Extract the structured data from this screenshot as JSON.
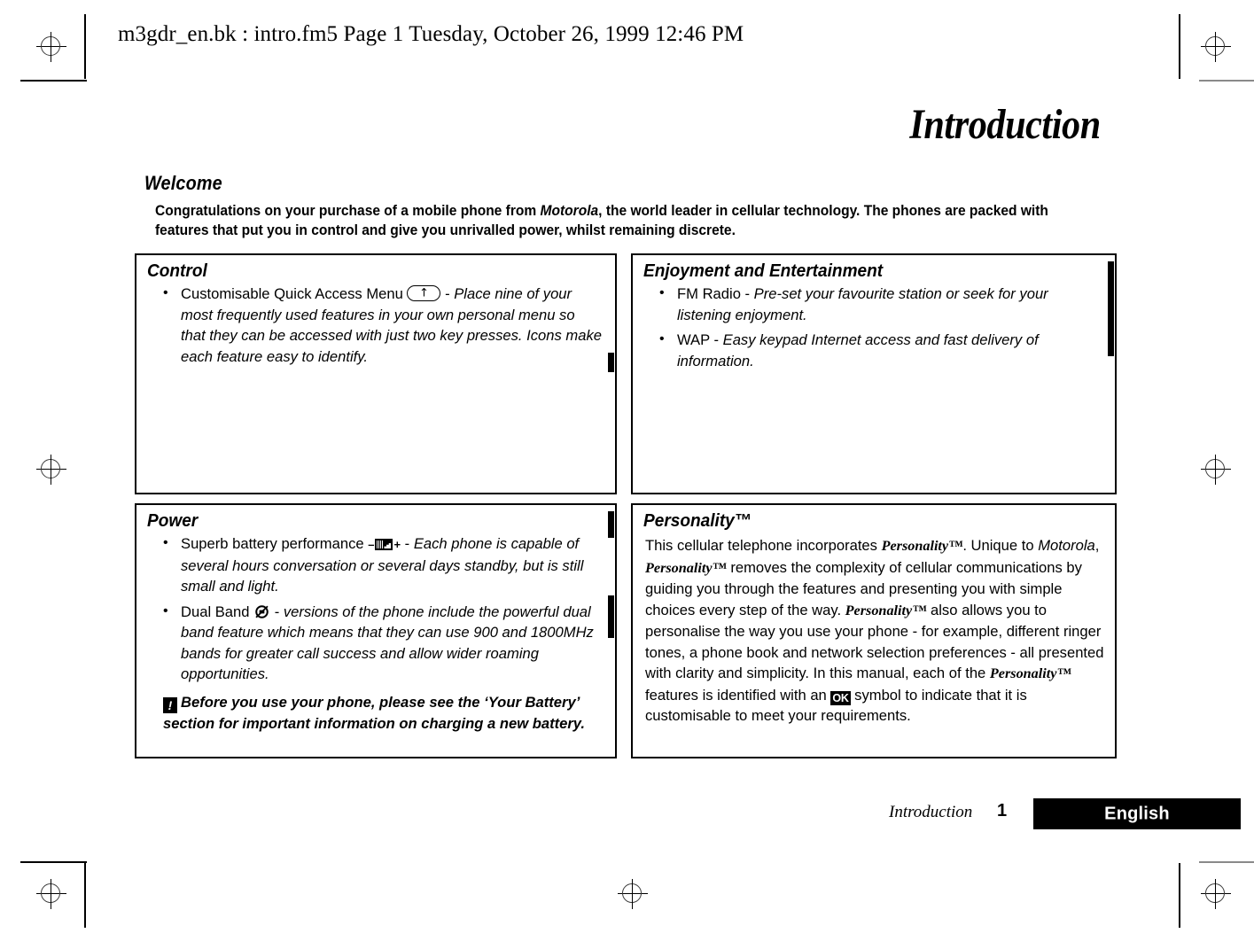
{
  "print_header": "m3gdr_en.bk : intro.fm5  Page 1  Tuesday, October 26, 1999  12:46 PM",
  "chapter_title": "Introduction",
  "welcome": {
    "heading": "Welcome",
    "body_part1": "Congratulations on your purchase of a mobile phone from ",
    "body_brand": "Motorola",
    "body_part2": ", the world leader in cellular technology. The phones are packed with features that put you in control and give you unrivalled power, whilst remaining discrete."
  },
  "boxes": {
    "control": {
      "heading": "Control",
      "items": [
        {
          "lead_a": "Customisable Quick Access Menu ",
          "icon": "quick-access-menu-icon",
          "lead_b": " - ",
          "desc": "Place nine of your most frequently used features in your own personal menu so that they can be accessed with just two key presses. Icons make each feature easy to identify."
        }
      ]
    },
    "enjoyment": {
      "heading": "Enjoyment and Entertainment",
      "items": [
        {
          "lead_a": "FM Radio - ",
          "desc": "Pre-set your favourite station or seek for your listening enjoyment."
        },
        {
          "lead_a": "WAP - ",
          "desc": "Easy keypad Internet access and fast delivery of information."
        }
      ]
    },
    "power": {
      "heading": "Power",
      "items": [
        {
          "lead_a": "Superb battery performance ",
          "icon": "battery-level-icon",
          "lead_b": " - ",
          "desc": "Each phone is capable of several hours conversation or several days standby, but is still small and light."
        },
        {
          "lead_a": "Dual Band ",
          "icon": "dual-band-icon",
          "lead_b": " - ",
          "desc": "versions of the phone include the powerful dual band feature which means that they can use 900 and 1800MHz bands for greater call success and allow wider roaming opportunities."
        }
      ],
      "warning_icon": "!",
      "warning": "Before you use your phone, please see the ‘Your Battery’ section for important information on charging a new battery."
    },
    "personality": {
      "heading": "Personality™",
      "p1": "This cellular telephone incorporates ",
      "brand1": "Personality™",
      "p2": ". Unique to ",
      "motorola": "Motorola",
      "p3": ", ",
      "brand2": "Personality™",
      "p4": " removes the complexity of cellular communications by guiding you through the features and presenting you with simple choices every step of the way. ",
      "brand3": "Personality™",
      "p5": " also allows you to personalise the way you use your phone - for example, different ringer tones, a phone book and network selection preferences - all presented with clarity and simplicity. In this manual, each of the ",
      "brand4": "Personality™",
      "p6": " features is identified with an ",
      "ok_badge": "OK",
      "p7": " symbol to indicate that it is customisable to meet your requirements."
    }
  },
  "footer": {
    "section": "Introduction",
    "page_number": "1",
    "language": "English"
  },
  "colors": {
    "ink": "#000000",
    "paper": "#ffffff"
  }
}
